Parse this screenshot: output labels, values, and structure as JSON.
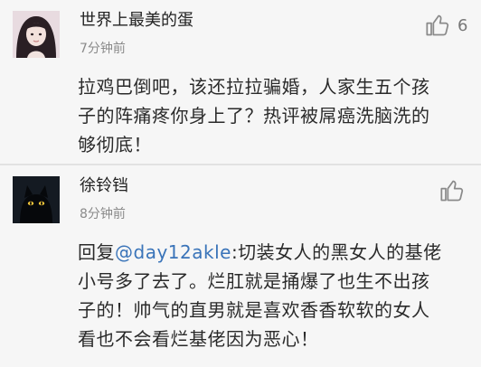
{
  "comments": [
    {
      "username": "世界上最美的蛋",
      "time": "7分钟前",
      "likes": "6",
      "avatar": "girl-portrait-avatar",
      "lines": [
        "拉鸡巴倒吧，该还拉拉骗婚，人家生五个孩",
        "子的阵痛疼你身上了？热评被屌癌洗脑洗的",
        "够彻底！"
      ]
    },
    {
      "username": "徐铃铛",
      "time": "8分钟前",
      "likes": "",
      "avatar": "black-cat-avatar",
      "reply_prefix": "回复",
      "mention": "@day12akle",
      "line1_rest": ":切装女人的黑女人的基佬",
      "lines": [
        "小号多了去了。烂肛就是捅爆了也生不出孩",
        "子的！帅气的直男就是喜欢香香软软的女人",
        "看也不会看烂基佬因为恶心！"
      ]
    }
  ],
  "colors": {
    "background": "#f6f6f6",
    "mention": "#3a74b9",
    "divider": "#e2e2e2"
  }
}
